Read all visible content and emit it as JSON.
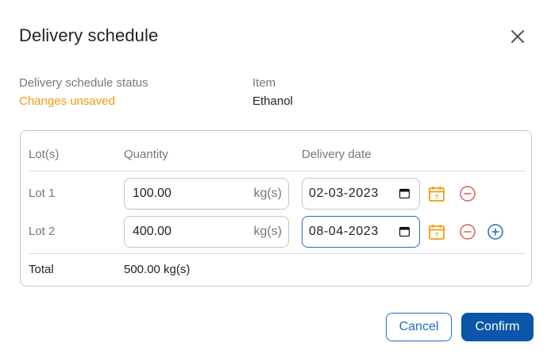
{
  "dialog": {
    "title": "Delivery schedule",
    "status_label": "Delivery schedule status",
    "status_value": "Changes unsaved",
    "item_label": "Item",
    "item_value": "Ethanol"
  },
  "table": {
    "headers": {
      "lot": "Lot(s)",
      "quantity": "Quantity",
      "delivery_date": "Delivery date"
    },
    "rows": [
      {
        "lot": "Lot 1",
        "quantity": "100.00",
        "unit": "kg(s)",
        "date": "02-03-2023"
      },
      {
        "lot": "Lot 2",
        "quantity": "400.00",
        "unit": "kg(s)",
        "date": "08-04-2023"
      }
    ],
    "total_label": "Total",
    "total_value": "500.00 kg(s)"
  },
  "footer": {
    "cancel_label": "Cancel",
    "confirm_label": "Confirm"
  },
  "icons": {
    "close": "close-icon",
    "calendar": "calendar-icon",
    "remove": "minus-circle-icon",
    "add": "plus-circle-icon"
  },
  "colors": {
    "accent": "#0b56a8",
    "link": "#1f6fc0",
    "warning": "#f29b0c",
    "remove": "#e05a5a"
  }
}
